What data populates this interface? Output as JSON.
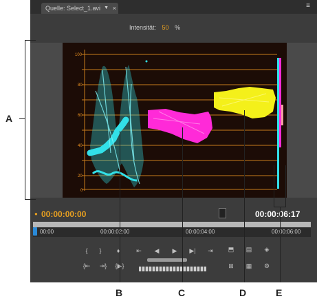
{
  "tab": {
    "label": "Quelle: Select_1.avi"
  },
  "intensity": {
    "label": "Intensität:",
    "value": "50",
    "unit": "%"
  },
  "scope": {
    "colors": {
      "background": "#1c0c06",
      "grid": "#e89020",
      "cyan": "#32e0e8",
      "magenta": "#ff2ad8",
      "yellow": "#f4f01a"
    },
    "scale_labels": [
      "100",
      "80",
      "60",
      "40",
      "20",
      "0"
    ]
  },
  "timecode": {
    "current": "00:00:00:00",
    "duration": "00:00:06:17"
  },
  "ruler": {
    "labels": [
      "00:00",
      "00:00:02:00",
      "00:00:04:00",
      "00:00:06:00"
    ]
  },
  "callouts": {
    "a": "A",
    "b": "B",
    "c": "C",
    "d": "D",
    "e": "E"
  }
}
